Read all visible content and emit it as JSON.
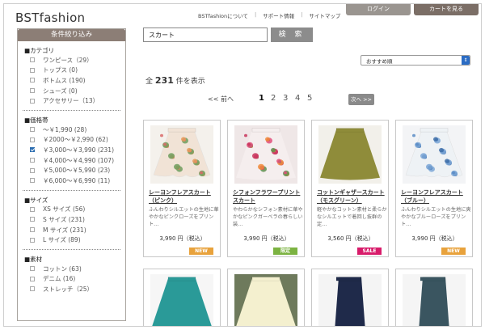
{
  "header": {
    "logo": "BSTfashion",
    "links": [
      "BSTfashionについて",
      "サポート情報",
      "サイトマップ"
    ],
    "login_label": "ログイン",
    "cart_label": "カートを見る"
  },
  "sidebar": {
    "title": "条件絞り込み",
    "groups": [
      {
        "title": "■カテゴリ",
        "options": [
          {
            "label": "ワンピース（29）",
            "checked": false
          },
          {
            "label": "トップス (0)",
            "checked": false
          },
          {
            "label": "ボトムス (190)",
            "checked": false
          },
          {
            "label": "シューズ (0)",
            "checked": false
          },
          {
            "label": "アクセサリー（13）",
            "checked": false
          }
        ]
      },
      {
        "title": "■価格帯",
        "options": [
          {
            "label": "～￥1,990 (28)",
            "checked": false
          },
          {
            "label": "￥2000～￥2,990 (62)",
            "checked": false
          },
          {
            "label": "￥3,000～￥3,990 (231)",
            "checked": true
          },
          {
            "label": "￥4,000～￥4,990 (107)",
            "checked": false
          },
          {
            "label": "￥5,000～￥5,990 (23)",
            "checked": false
          },
          {
            "label": "￥6,000～￥6,990 (11)",
            "checked": false
          }
        ]
      },
      {
        "title": "■サイズ",
        "options": [
          {
            "label": "XS サイズ (56)",
            "checked": false
          },
          {
            "label": "S サイズ (231)",
            "checked": false
          },
          {
            "label": "M サイズ (231)",
            "checked": false
          },
          {
            "label": "L サイズ (89)",
            "checked": false
          }
        ]
      },
      {
        "title": "■素材",
        "options": [
          {
            "label": "コットン (63)",
            "checked": false
          },
          {
            "label": "デニム (16)",
            "checked": false
          },
          {
            "label": "ストレッチ（25）",
            "checked": false
          }
        ]
      }
    ]
  },
  "search": {
    "value": "スカート",
    "button_label": "検 索"
  },
  "sort": {
    "selected": "おすすめ順"
  },
  "results": {
    "prefix": "全",
    "count": "231",
    "suffix": "件を表示"
  },
  "pager": {
    "prev": "<< 前へ",
    "pages": [
      "1",
      "2",
      "3",
      "4",
      "5"
    ],
    "current": "1",
    "next": "次へ >>"
  },
  "products": [
    {
      "title": "レーヨンフレアスカート（ピンク）",
      "desc": "ふんわりシルエットの生地に華やかなピンクローズをプリント…",
      "price": "3,990 円（税込）",
      "badge": "NEW",
      "badge_color": "#e8a23c",
      "swatch": "pink-floral"
    },
    {
      "title": "シフォンフラワープリントスカート",
      "desc": "やわらかなシフォン素材に華やかなピンクガーベラの春らしい装…",
      "price": "3,990 円（税込）",
      "badge": "限定",
      "badge_color": "#7cb342",
      "swatch": "red-floral"
    },
    {
      "title": "コットンギャザースカート（モスグリーン）",
      "desc": "軽やかなコットン素材と柔らかなシルエットで着回し抜群の定…",
      "price": "3,560 円（税込）",
      "badge": "SALE",
      "badge_color": "#d81b6a",
      "swatch": "olive"
    },
    {
      "title": "レーヨンフレアスカート（ブルー）",
      "desc": "ふんわりシルエットの生地に爽やかなブルーローズをプリント…",
      "price": "3,990 円（税込）",
      "badge": "NEW",
      "badge_color": "#e8a23c",
      "swatch": "blue-floral"
    },
    {
      "title": "",
      "desc": "",
      "price": "",
      "badge": "",
      "badge_color": "",
      "swatch": "teal"
    },
    {
      "title": "",
      "desc": "",
      "price": "",
      "badge": "",
      "badge_color": "",
      "swatch": "cream"
    },
    {
      "title": "",
      "desc": "",
      "price": "",
      "badge": "",
      "badge_color": "",
      "swatch": "navy"
    },
    {
      "title": "",
      "desc": "",
      "price": "",
      "badge": "",
      "badge_color": "",
      "swatch": "tweed"
    }
  ]
}
